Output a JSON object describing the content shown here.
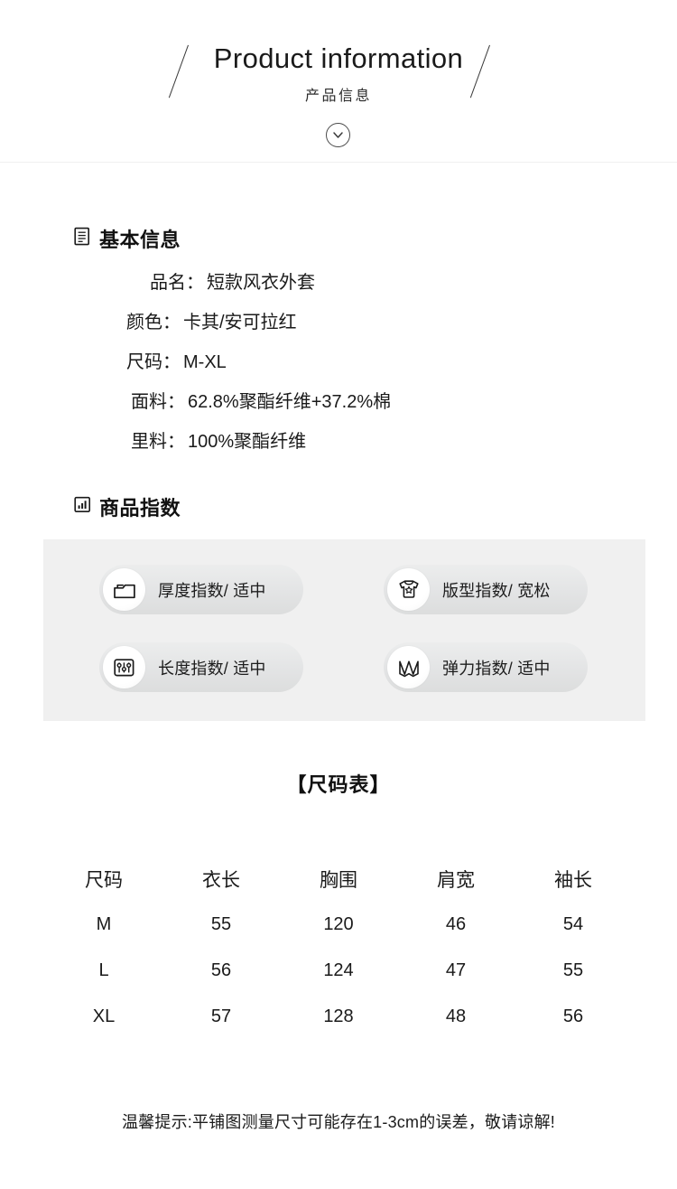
{
  "header": {
    "title_en": "Product information",
    "title_cn": "产品信息",
    "left_slash_icon": "diagonal-slash",
    "right_slash_icon": "diagonal-slash",
    "expand_icon": "chevron-down-circle-icon"
  },
  "basic_info": {
    "heading": "基本信息",
    "heading_icon": "document-icon",
    "rows": [
      {
        "label": "品名：",
        "value": "短款风衣外套"
      },
      {
        "label": "颜色：",
        "value": "卡其/安可拉红"
      },
      {
        "label": "尺码：",
        "value": "M-XL"
      },
      {
        "label": "面料：",
        "value": "62.8%聚酯纤维+37.2%棉"
      },
      {
        "label": "里料：",
        "value": "100%聚酯纤维"
      }
    ]
  },
  "product_index": {
    "heading": "商品指数",
    "heading_icon": "bar-chart-icon",
    "panel_bg": "#f0f0f0",
    "items": [
      {
        "text": "厚度指数/ 适中",
        "icon": "fabric-layers-icon"
      },
      {
        "text": "版型指数/ 宽松",
        "icon": "tshirt-icon"
      },
      {
        "text": "长度指数/ 适中",
        "icon": "sliders-icon"
      },
      {
        "text": "弹力指数/ 适中",
        "icon": "folded-map-icon"
      }
    ]
  },
  "size_chart": {
    "title": "【尺码表】",
    "columns": [
      "尺码",
      "衣长",
      "胸围",
      "肩宽",
      "袖长"
    ],
    "rows": [
      [
        "M",
        "55",
        "120",
        "46",
        "54"
      ],
      [
        "L",
        "56",
        "124",
        "47",
        "55"
      ],
      [
        "XL",
        "57",
        "128",
        "48",
        "56"
      ]
    ]
  },
  "footer": {
    "note": "温馨提示:平铺图测量尺寸可能存在1-3cm的误差，敬请谅解!"
  }
}
